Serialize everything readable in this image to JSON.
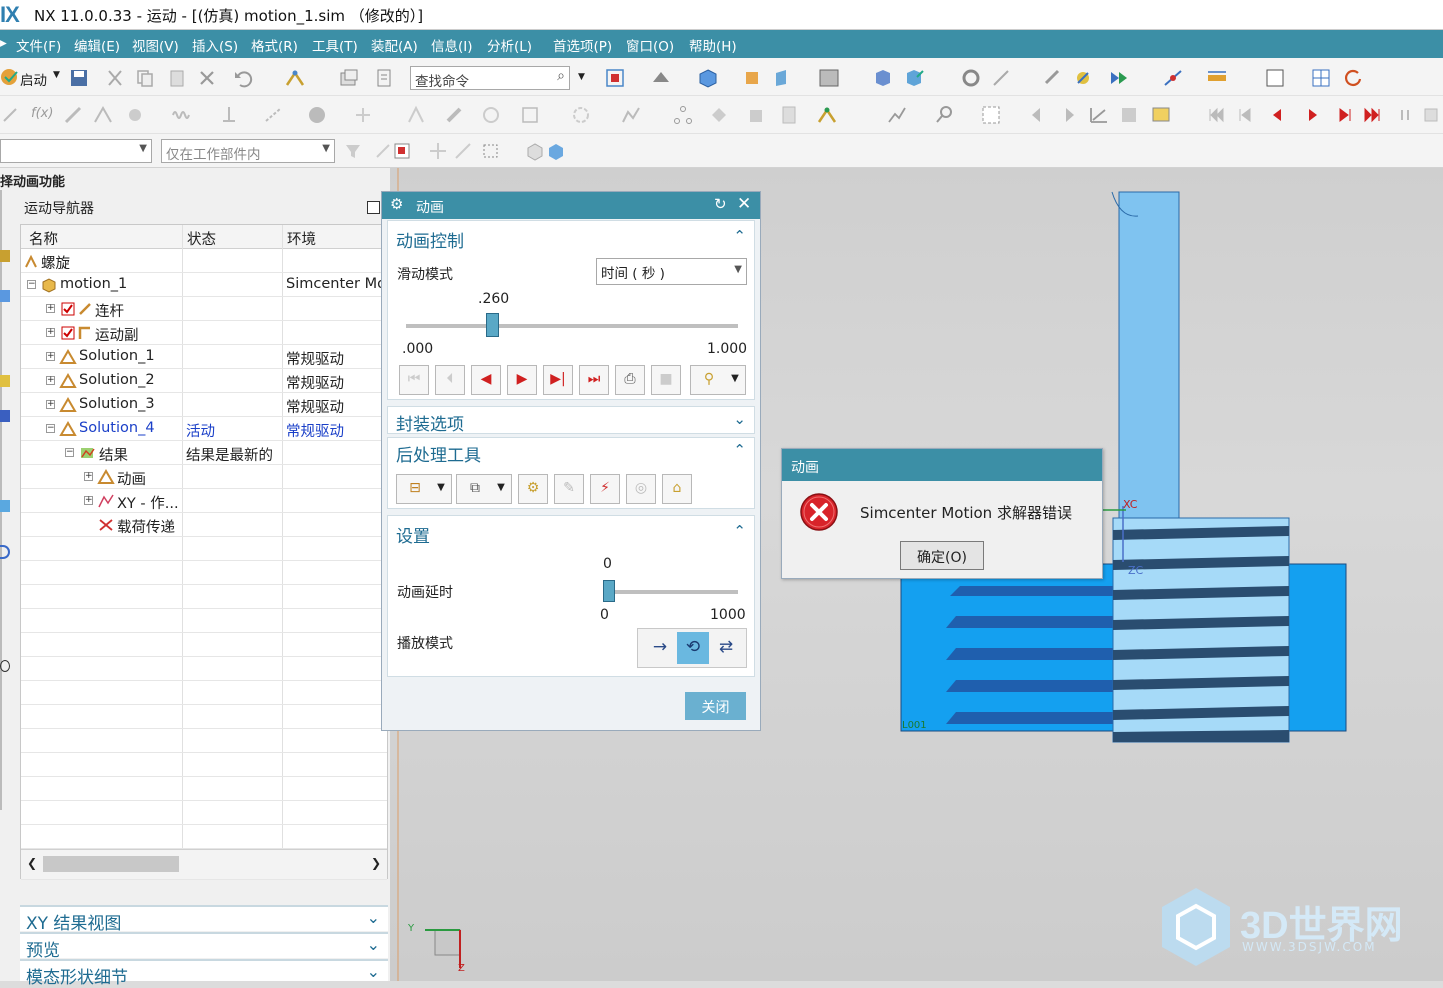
{
  "app": {
    "logo": "IX",
    "title": "NX 11.0.0.33 - 运动 - [(仿真) motion_1.sim （修改的）]"
  },
  "menu": [
    "文件(F)",
    "编辑(E)",
    "视图(V)",
    "插入(S)",
    "格式(R)",
    "工具(T)",
    "装配(A)",
    "信息(I)",
    "分析(L)",
    "首选项(P)",
    "窗口(O)",
    "帮助(H)"
  ],
  "toolbar": {
    "start_label": "启动",
    "search_placeholder": "查找命令",
    "scope_value": "仅在工作部件内",
    "fx_label": "f(x)"
  },
  "left": {
    "header_hint": "择动画功能",
    "navigator_title": "运动导航器",
    "columns": [
      "名称",
      "状态",
      "环境"
    ],
    "rows": [
      {
        "name": "螺旋",
        "status": "",
        "env": ""
      },
      {
        "name": "motion_1",
        "status": "",
        "env": "Simcenter Mo"
      },
      {
        "name": "连杆",
        "status": "",
        "env": ""
      },
      {
        "name": "运动副",
        "status": "",
        "env": ""
      },
      {
        "name": "Solution_1",
        "status": "",
        "env": "常规驱动"
      },
      {
        "name": "Solution_2",
        "status": "",
        "env": "常规驱动"
      },
      {
        "name": "Solution_3",
        "status": "",
        "env": "常规驱动"
      },
      {
        "name": "Solution_4",
        "status": "活动",
        "env": "常规驱动"
      },
      {
        "name": "结果",
        "status": "结果是最新的",
        "env": ""
      },
      {
        "name": "动画",
        "status": "",
        "env": ""
      },
      {
        "name": "XY - 作...",
        "status": "",
        "env": ""
      },
      {
        "name": "载荷传递",
        "status": "",
        "env": ""
      }
    ],
    "sections": [
      "XY 结果视图",
      "预览",
      "模态形状细节"
    ]
  },
  "anim_dialog": {
    "title": "动画",
    "control_title": "动画控制",
    "slide_mode_label": "滑动模式",
    "slide_mode_value": "时间 ( 秒 )",
    "slider_value": ".260",
    "slider_position": 0.26,
    "slider_min": ".000",
    "slider_max": "1.000",
    "package_title": "封装选项",
    "post_title": "后处理工具",
    "settings_title": "设置",
    "delay_label": "动画延时",
    "delay_value": "0",
    "delay_min": "0",
    "delay_max": "1000",
    "play_mode_label": "播放模式",
    "close_label": "关闭"
  },
  "error_dialog": {
    "title": "动画",
    "message": "Simcenter Motion 求解器错误",
    "ok_label": "确定(O)"
  },
  "viewport": {
    "axis_xc": "XC",
    "axis_zc": "ZC",
    "axis_y": "Y",
    "axis_z": "Z",
    "part_label": "L001",
    "watermark": "3D世界网",
    "watermark_sub": "WWW.3DSJW.COM"
  },
  "colors": {
    "accent": "#3c8fa6",
    "part": "#14a0f0",
    "nut": "#8fd0f7",
    "error": "#d8232a"
  }
}
